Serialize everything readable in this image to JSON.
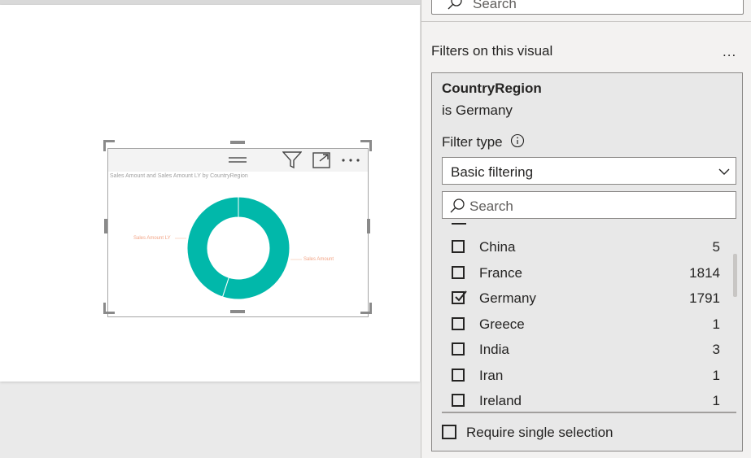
{
  "visual": {
    "title": "Sales Amount and Sales Amount LY by CountryRegion",
    "icons": [
      "drag-handle-icon",
      "filter-icon",
      "focus-mode-icon",
      "more-options-icon"
    ],
    "chart_data": {
      "type": "pie",
      "title": "Sales Amount and Sales Amount LY by CountryRegion",
      "labels": [
        "Sales Amount",
        "Sales Amount LY"
      ],
      "values": [
        55,
        45
      ],
      "colors": [
        "#01b8aa",
        "#01b8aa"
      ],
      "legend": "none"
    }
  },
  "pane": {
    "search_placeholder": "Search",
    "section_title": "Filters on this visual",
    "section_more": "...",
    "card": {
      "field": "CountryRegion",
      "condition": "is Germany",
      "filter_type_label": "Filter type",
      "filter_type_value": "Basic filtering",
      "search_placeholder": "Search",
      "items": [
        {
          "label": "China",
          "count": "5",
          "checked": false
        },
        {
          "label": "France",
          "count": "1814",
          "checked": false
        },
        {
          "label": "Germany",
          "count": "1791",
          "checked": true
        },
        {
          "label": "Greece",
          "count": "1",
          "checked": false
        },
        {
          "label": "India",
          "count": "3",
          "checked": false
        },
        {
          "label": "Iran",
          "count": "1",
          "checked": false
        },
        {
          "label": "Ireland",
          "count": "1",
          "checked": false
        }
      ],
      "require_single_label": "Require single selection"
    }
  }
}
